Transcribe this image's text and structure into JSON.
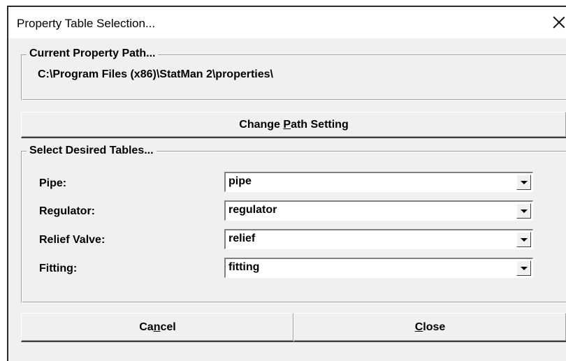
{
  "window": {
    "title": "Property Table Selection..."
  },
  "current_path": {
    "legend": "Current Property Path...",
    "value": "C:\\Program Files (x86)\\StatMan 2\\properties\\"
  },
  "change_path_button": {
    "pre": "Change ",
    "underlined": "P",
    "post": "ath Setting"
  },
  "tables": {
    "legend": "Select Desired Tables...",
    "rows": [
      {
        "label": "Pipe:",
        "value": "pipe"
      },
      {
        "label": "Regulator:",
        "value": "regulator"
      },
      {
        "label": "Relief Valve:",
        "value": "relief"
      },
      {
        "label": "Fitting:",
        "value": "fitting"
      }
    ]
  },
  "buttons": {
    "cancel": {
      "pre": "Ca",
      "underlined": "n",
      "post": "cel"
    },
    "close": {
      "pre": "",
      "underlined": "C",
      "post": "lose"
    }
  }
}
